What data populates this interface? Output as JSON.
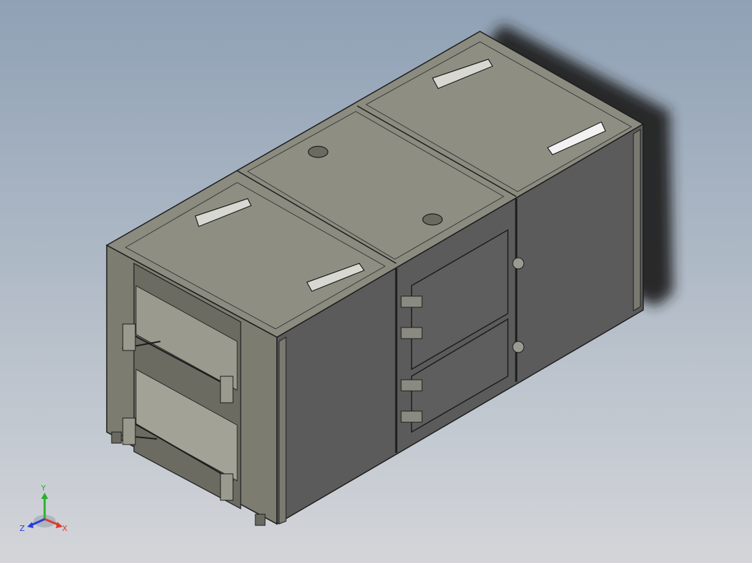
{
  "viewport": {
    "background_top": "#8fa1b5",
    "background_bottom": "#d3d5d9"
  },
  "model": {
    "colors": {
      "top_face": "#8b8b80",
      "top_panel": "#8e8e83",
      "front_face": "#5b5b5b",
      "end_face": "#7c7c70",
      "edge": "#1c1c1c",
      "shadow": "#202020",
      "slot": "#f2f2f2"
    }
  },
  "triad": {
    "x_label": "X",
    "y_label": "Y",
    "z_label": "Z",
    "x_color": "#e03a2a",
    "y_color": "#2ab02a",
    "z_color": "#2a3ae0"
  }
}
